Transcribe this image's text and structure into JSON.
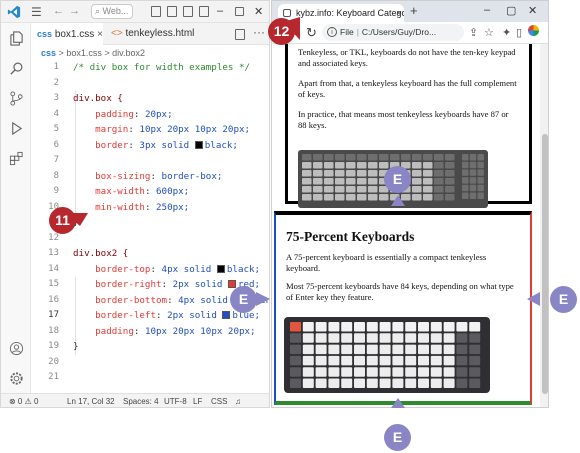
{
  "vscode": {
    "search_text": "Web...",
    "tabs": [
      {
        "badge": "css",
        "label": "box1.css",
        "close": "×"
      },
      {
        "badge": "<>",
        "label": "tenkeyless.html"
      }
    ],
    "breadcrumb": {
      "lang": "css",
      "file": "box1.css",
      "sep": ">",
      "symbol": "div.box2"
    },
    "line_numbers": [
      "1",
      "2",
      "3",
      "4",
      "5",
      "6",
      "7",
      "8",
      "9",
      "10",
      "11",
      "12",
      "13",
      "14",
      "15",
      "16",
      "17",
      "18",
      "19",
      "20",
      "21"
    ],
    "current_line": "17",
    "code": {
      "l1": "/* div box for width examples */",
      "l3_sel": "div.box {",
      "l4": {
        "prop": "padding",
        "val": "20px;"
      },
      "l5": {
        "prop": "margin",
        "val": "10px 20px 10px 20px;"
      },
      "l6": {
        "prop": "border",
        "val_pre": "3px solid ",
        "val_post": "black;"
      },
      "l8": {
        "prop": "box-sizing",
        "val": "border-box;"
      },
      "l9": {
        "prop": "max-width",
        "val": "600px;"
      },
      "l10": {
        "prop": "min-width",
        "val": "250px;"
      },
      "l11": "}",
      "l13_sel": "div.box2 {",
      "l14": {
        "prop": "border-top",
        "val_pre": "4px solid ",
        "val_post": "black;"
      },
      "l15": {
        "prop": "border-right",
        "val_pre": "2px solid ",
        "val_post": "red;"
      },
      "l16": {
        "prop": "border-bottom",
        "val_pre": "4px solid ",
        "val_post": "green;"
      },
      "l17": {
        "prop": "border-left",
        "val_pre": "2px solid ",
        "val_post": "blue;"
      },
      "l18": {
        "prop": "padding",
        "val": "10px 20px 10px 20px;"
      },
      "l19": "}"
    },
    "status": {
      "problems": "⊗ 0 ⚠ 0",
      "position": "Ln 17, Col 32",
      "spaces": "Spaces: 4",
      "encoding": "UTF-8",
      "eol": "LF",
      "language": "CSS"
    }
  },
  "browser": {
    "tab_title": "kybz.info: Keyboard Categories",
    "tab_close": "×",
    "new_tab": "+",
    "omnibox": {
      "label": "File",
      "path": "C:/Users/Guy/Dro..."
    },
    "box1_paragraphs": [
      "Tenkeyless, or TKL, keyboards do not have the ten-key keypad and associated keys.",
      "Apart from that, a tenkeyless keyboard has the full complement of keys.",
      "In practice, that means most tenkeyless keyboards have 87 or 88 keys."
    ],
    "box2_heading": "75-Percent Keyboards",
    "box2_paragraphs": [
      "A 75-percent keyboard is essentially a compact tenkeyless keyboard.",
      "Most 75-percent keyboards have 84 keys, depending on what type of Enter key they feature."
    ]
  },
  "callouts": {
    "step11": "11",
    "step12": "12",
    "e": "E"
  },
  "colors": {
    "step": "#b6282d",
    "e": "#8a86c6",
    "top": "#000000",
    "right": "#e53935",
    "bottom": "#2e8b2e",
    "left": "#1e4fc2"
  }
}
